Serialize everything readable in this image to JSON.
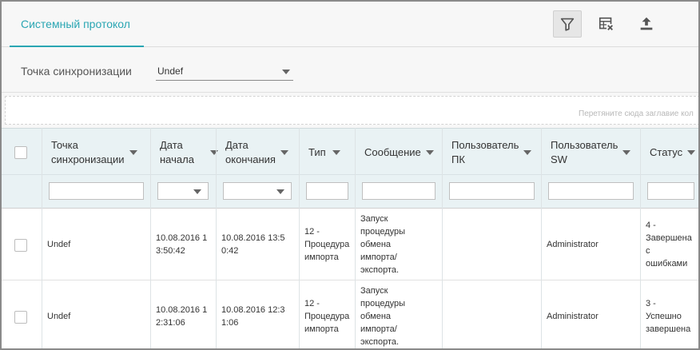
{
  "tabs": [
    {
      "label": "Системный протокол"
    }
  ],
  "toolbar": {
    "filter_icon": "filter-icon",
    "clear_columns_icon": "table-clear-icon",
    "export_icon": "upload-icon"
  },
  "filter": {
    "label": "Точка синхронизации",
    "value": "Undef"
  },
  "group_zone": {
    "hint": "Перетяните сюда заглавие кол"
  },
  "columns": [
    {
      "label": "Точка\nсинхронизации"
    },
    {
      "label": "Дата\nначала"
    },
    {
      "label": "Дата\nокончания"
    },
    {
      "label": "Тип"
    },
    {
      "label": "Сообщение"
    },
    {
      "label": "Пользователь\nПК"
    },
    {
      "label": "Пользователь\nSW"
    },
    {
      "label": "Статус"
    }
  ],
  "rows": [
    {
      "sync_point": "Undef",
      "start": "10.08.2016 1\n3:50:42",
      "end": "10.08.2016 13:5\n0:42",
      "type": "12 -\nПроцедура\nимпорта",
      "message": "Запуск\nпроцедуры\nобмена\nимпорта/\nэкспорта.",
      "pc_user": "",
      "sw_user": "Administrator",
      "status": "4 -\nЗавершена\nс\nошибками"
    },
    {
      "sync_point": "Undef",
      "start": "10.08.2016 1\n2:31:06",
      "end": "10.08.2016 12:3\n1:06",
      "type": "12 -\nПроцедура\nимпорта",
      "message": "Запуск\nпроцедуры\nобмена\nимпорта/\nэкспорта.",
      "pc_user": "",
      "sw_user": "Administrator",
      "status": "3 -\nУспешно\nзавершена"
    }
  ]
}
